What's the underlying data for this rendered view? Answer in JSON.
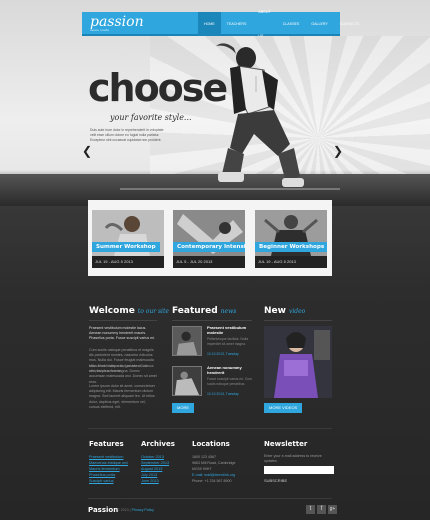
{
  "header": {
    "logo": "passion",
    "tagline": "dance studio",
    "nav": [
      "HOME",
      "TEACHERS",
      "ABOUT US",
      "CLASSES",
      "GALLERY",
      "CONTACTS"
    ]
  },
  "hero": {
    "title": "choose",
    "subtitle": "your favorite style...",
    "text": "Duis aute irure dolor in reprehenderit in voluptate velit esse cillum dolore eu fugiat nulla pariatur. Excepteur sint occaecat cupidatat non proident.",
    "prev_icon": "chevron-left-icon",
    "next_icon": "chevron-right-icon"
  },
  "workshops": [
    {
      "title": "Summer Workshop",
      "date": "JUL 19 - AUG 5 2013"
    },
    {
      "title": "Contemporary Intensive",
      "date": "JUL 5 - JUL 20 2013"
    },
    {
      "title": "Beginner Workshops",
      "date": "JUL 19 - AUG 5 2013"
    }
  ],
  "welcome": {
    "heading": "Welcome",
    "heading_em": "to our site",
    "lead": "Praesent vestibulum molestie lacus. Aenean nonummy hendrerit mauris. Phasellus porta. Fusce suscipit varius mi.",
    "p1": "Cum sociis natoque penatibus et magnis dis parturient montes, nascetur ridiculus mus. Nulla dui. Fusce feugiat malesuada odio. Morbi nunc odio, gravida at, cursus nec, luctus a, lorem.",
    "p2": "Maecenas tristique orci ac sem. Duis ultricies pharetra magna. Donec accumsan malesuada orci. Donec sit amet eros.",
    "p3": "Lorem ipsum dolor sit amet, consectetuer adipiscing elit. Mauris fermentum dictum magna. Sed laoreet aliquam leo. Ut tellus dolor, dapibus eget, elementum vel, cursus eleifend, elit.",
    "more": "more"
  },
  "featured": {
    "heading": "Featured",
    "heading_em": "news",
    "items": [
      {
        "title": "Praesent vestibulum molestie",
        "text": "Pellentesque facilisis. Nulla imperdiet sit amet magna.",
        "date": "10.10.2013, Tuesday"
      },
      {
        "title": "Aenean nonummy hendrerit",
        "text": "Fusce suscipit varius mi. Cum sociis natoque penatibus.",
        "date": "10.10.2013, Tuesday"
      }
    ],
    "more": "more"
  },
  "video": {
    "heading": "New",
    "heading_em": "video",
    "more": "more videos"
  },
  "footer": {
    "features": {
      "heading": "Features",
      "items": [
        "Praesent vestibulum",
        "Maecenas tristique orci",
        "Mauris fermentum",
        "Phasellus porta",
        "Suscipit varius"
      ]
    },
    "archives": {
      "heading": "Archives",
      "items": [
        "October 2013",
        "September 2013",
        "August 2013",
        "July 2013",
        "June 2013"
      ]
    },
    "locations": {
      "heading": "Locations",
      "lines": [
        "1800 123 4567",
        "9863 Mill Road, Cambridge",
        "MG09 99HT",
        "E-mail: mail@demolink.org",
        "Phone: +1 234 567 8900"
      ]
    },
    "newsletter": {
      "heading": "Newsletter",
      "text": "Enter your e-mail address to receive updates",
      "placeholder": "",
      "subscribe": "subscribe"
    },
    "brand": "Passion",
    "copyright": "© 2013",
    "privacy": "Privacy Policy"
  }
}
